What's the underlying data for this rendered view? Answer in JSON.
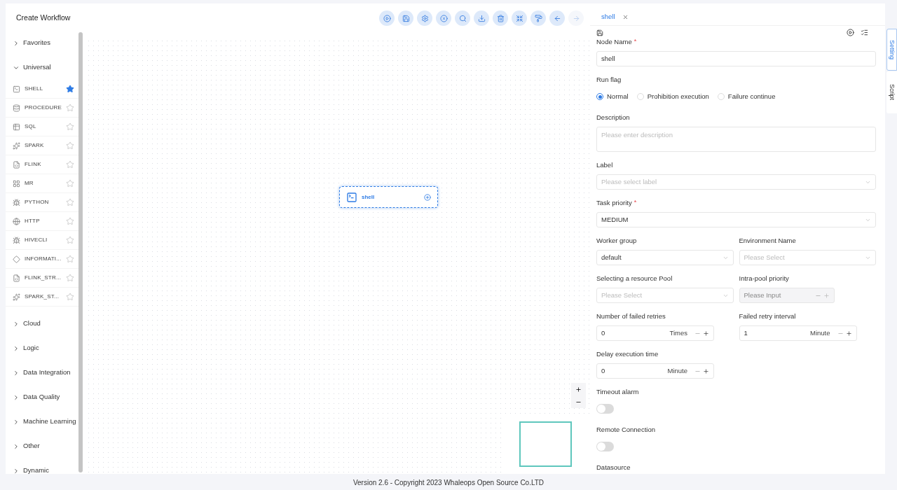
{
  "window": {
    "title": "Create Workflow"
  },
  "toolbar": [
    {
      "kind": "run",
      "disabled": false
    },
    {
      "kind": "save",
      "disabled": false
    },
    {
      "kind": "settings",
      "disabled": false
    },
    {
      "kind": "close",
      "disabled": false
    },
    {
      "kind": "search",
      "disabled": false
    },
    {
      "kind": "download",
      "disabled": false
    },
    {
      "kind": "delete",
      "disabled": false
    },
    {
      "kind": "fit",
      "disabled": false
    },
    {
      "kind": "format",
      "disabled": false
    },
    {
      "kind": "undo",
      "disabled": false
    },
    {
      "kind": "redo",
      "disabled": true
    }
  ],
  "sidebar": {
    "groups": [
      {
        "label": "Favorites",
        "expanded": false
      },
      {
        "label": "Universal",
        "expanded": true,
        "items": [
          {
            "label": "SHELL",
            "favorite": true
          },
          {
            "label": "PROCEDURE",
            "favorite": false
          },
          {
            "label": "SQL",
            "favorite": false
          },
          {
            "label": "SPARK",
            "favorite": false
          },
          {
            "label": "FLINK",
            "favorite": false
          },
          {
            "label": "MR",
            "favorite": false
          },
          {
            "label": "PYTHON",
            "favorite": false
          },
          {
            "label": "HTTP",
            "favorite": false
          },
          {
            "label": "HIVECLI",
            "favorite": false
          },
          {
            "label": "INFORMATI...",
            "favorite": false
          },
          {
            "label": "FLINK_STR...",
            "favorite": false
          },
          {
            "label": "SPARK_ST...",
            "favorite": false
          }
        ]
      },
      {
        "label": "Cloud",
        "expanded": false
      },
      {
        "label": "Logic",
        "expanded": false
      },
      {
        "label": "Data Integration",
        "expanded": false
      },
      {
        "label": "Data Quality",
        "expanded": false
      },
      {
        "label": "Machine Learning",
        "expanded": false
      },
      {
        "label": "Other",
        "expanded": false
      },
      {
        "label": "Dynamic",
        "expanded": false
      }
    ]
  },
  "canvas": {
    "node": {
      "label": "shell",
      "selected": true
    }
  },
  "panel": {
    "tab": {
      "label": "shell"
    },
    "form": [
      [
        {
          "kind": "text",
          "label": "Node Name",
          "required_mark": "*",
          "value": "shell"
        }
      ],
      [
        {
          "kind": "radio",
          "label": "Run flag",
          "options": [
            {
              "label": "Normal",
              "selected": true
            },
            {
              "label": "Prohibition execution",
              "selected": false
            },
            {
              "label": "Failure continue",
              "selected": false
            }
          ]
        }
      ],
      [
        {
          "kind": "textarea",
          "label": "Description",
          "placeholder": "Please enter description"
        }
      ],
      [
        {
          "kind": "select",
          "label": "Label",
          "placeholder": "Please select label"
        }
      ],
      [
        {
          "kind": "select",
          "label": "Task priority",
          "required_mark": "*",
          "value": "MEDIUM"
        }
      ],
      [
        {
          "kind": "select",
          "label": "Worker group",
          "value": "default"
        },
        {
          "kind": "select",
          "label": "Environment Name",
          "placeholder": "Please Select"
        }
      ],
      [
        {
          "kind": "select",
          "label": "Selecting a resource Pool",
          "placeholder": "Please Select"
        },
        {
          "kind": "number",
          "label": "Intra-pool priority",
          "placeholder": "Please Input",
          "disabled": true
        }
      ],
      [
        {
          "kind": "number",
          "label": "Number of failed retries",
          "value": "0",
          "unit": "Times"
        },
        {
          "kind": "number",
          "label": "Failed retry interval",
          "value": "1",
          "unit": "Minute"
        }
      ],
      [
        {
          "kind": "number",
          "label": "Delay execution time",
          "value": "0",
          "unit": "Minute"
        }
      ],
      [
        {
          "kind": "switch",
          "label": "Timeout alarm",
          "on": false
        }
      ],
      [
        {
          "kind": "switch",
          "label": "Remote Connection",
          "on": false
        }
      ],
      [
        {
          "kind": "heading",
          "label": "Datasource"
        }
      ]
    ]
  },
  "side_tabs": [
    {
      "label": "Setting",
      "selected": true
    },
    {
      "label": "Script",
      "selected": false
    }
  ],
  "footer": "Version 2.6 - Copyright 2023 Whaleops Open Source Co.LTD"
}
